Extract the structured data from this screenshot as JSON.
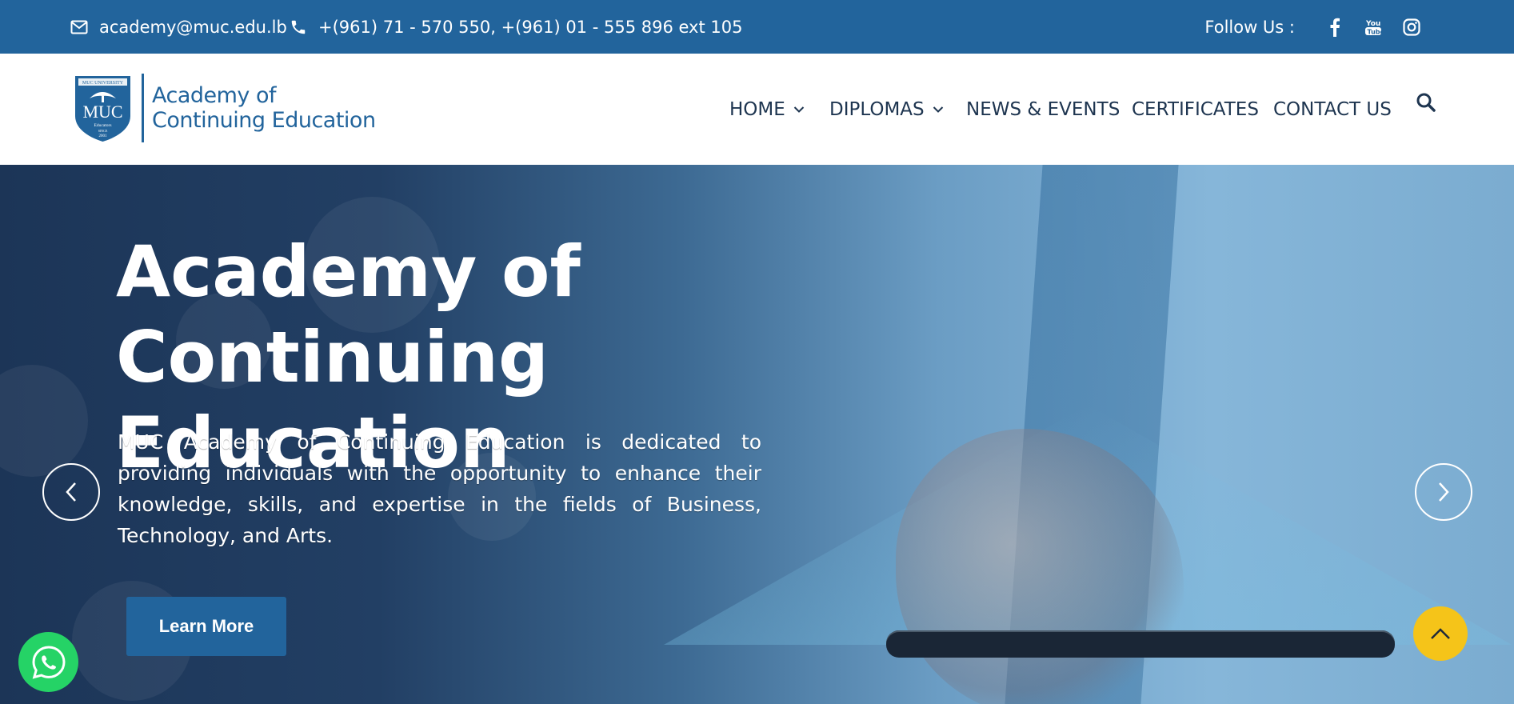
{
  "topbar": {
    "email": "academy@muc.edu.lb",
    "phone": "+(961) 71 - 570 550, +(961) 01 - 555 896 ext 105",
    "follow_label": "Follow Us :",
    "social_icons": [
      "facebook-icon",
      "youtube-icon",
      "instagram-icon"
    ]
  },
  "logo": {
    "crest_top": "MUC UNIVERSITY",
    "crest_letters": "MUC",
    "crest_motto": "Educators",
    "crest_since": "SINCE",
    "crest_year": "2001",
    "line1": "Academy of",
    "line2": "Continuing Education"
  },
  "nav": {
    "items": [
      {
        "label": "HOME",
        "has_dropdown": true
      },
      {
        "label": "DIPLOMAS",
        "has_dropdown": true
      },
      {
        "label": "NEWS & EVENTS",
        "has_dropdown": false
      },
      {
        "label": "CERTIFICATES",
        "has_dropdown": false
      },
      {
        "label": "CONTACT US",
        "has_dropdown": false
      }
    ],
    "search_icon": "search-icon"
  },
  "hero": {
    "title_line1": "Academy of",
    "title_line2": "Continuing Education",
    "description": "MUC Academy of Continuing Education is dedicated to providing individuals with the opportunity to enhance their knowledge, skills, and expertise in the fields of Business, Technology, and Arts.",
    "cta_label": "Learn More"
  },
  "colors": {
    "brand_blue": "#22649c",
    "nav_text": "#1e3550",
    "whatsapp_green": "#25d366",
    "scroll_top_yellow": "#f5c419"
  }
}
